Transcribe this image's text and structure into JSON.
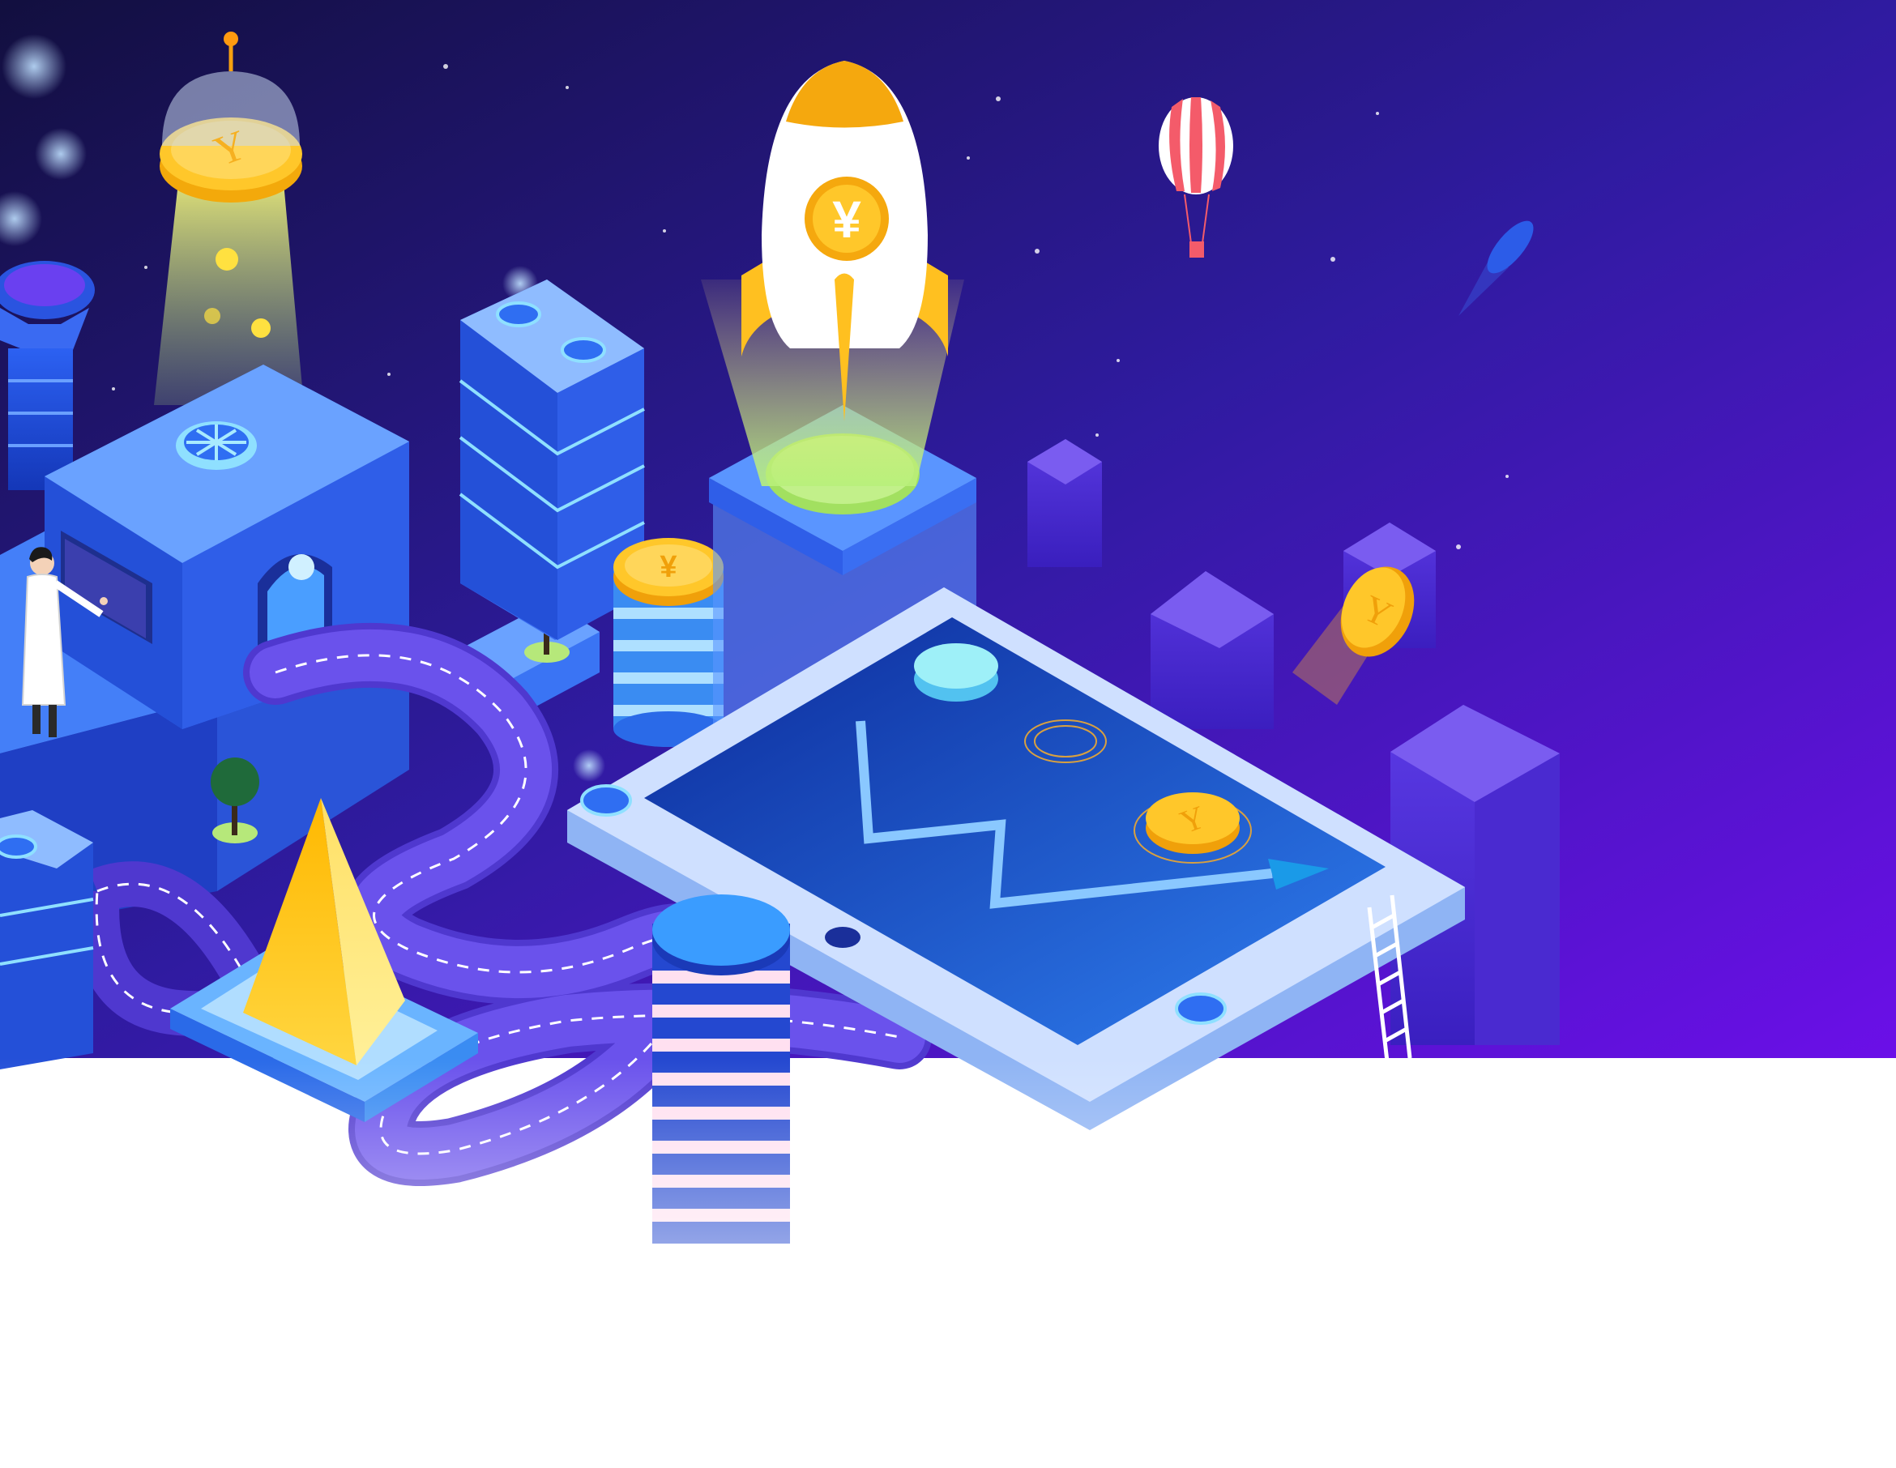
{
  "scene": {
    "subject": "isometric-fintech-city",
    "colors": {
      "sky_top": "#14124a",
      "sky_bottom": "#6a10e6",
      "platform_blue": "#2f6ff0",
      "platform_light": "#cfe0ff",
      "coin_gold": "#f5b20a",
      "coin_light": "#ffd84a",
      "road_purple": "#5a3fd6",
      "beacon_yellow": "#f0e86a"
    },
    "symbols": {
      "yen": "¥",
      "coin_y": "Y"
    },
    "icons": [
      "rocket-icon",
      "hot-air-balloon-icon",
      "comet-icon",
      "tablet-chart-icon",
      "coin-stack-icon",
      "pyramid-icon",
      "person-icon",
      "tree-icon",
      "ladder-icon",
      "fan-icon"
    ]
  }
}
